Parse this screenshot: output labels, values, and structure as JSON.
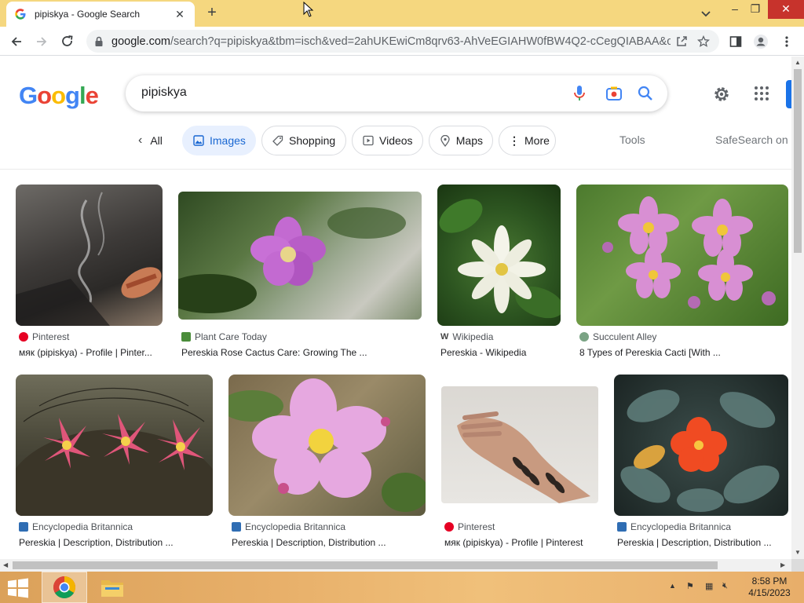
{
  "browser": {
    "tab_title": "pipiskya - Google Search",
    "url_host": "google.com",
    "url_path": "/search?q=pipiskya&tbm=isch&ved=2ahUKEwiCm8qrv63-AhVeEGIAHW0fBW4Q2-cCegQIABAA&oq..."
  },
  "search": {
    "logo": "Google",
    "query": "pipiskya"
  },
  "nav": {
    "all": "All",
    "images": "Images",
    "shopping": "Shopping",
    "videos": "Videos",
    "maps": "Maps",
    "more": "More",
    "tools": "Tools",
    "safesearch": "SafeSearch on"
  },
  "results": [
    {
      "source": "Pinterest",
      "title": "мяк (pipiskya) - Profile | Pinter...",
      "icon": "pinterest-icon",
      "icon_color": "#e60023"
    },
    {
      "source": "Plant Care Today",
      "title": "Pereskia Rose Cactus Care: Growing The ...",
      "icon": "leaf-icon",
      "icon_color": "#4a8c3a"
    },
    {
      "source": "Wikipedia",
      "title": "Pereskia - Wikipedia",
      "icon": "wikipedia-icon",
      "icon_color": "#444444"
    },
    {
      "source": "Succulent Alley",
      "title": "8 Types of Pereskia Cacti [With ...",
      "icon": "succulent-icon",
      "icon_color": "#7aa384"
    },
    {
      "source": "Encyclopedia Britannica",
      "title": "Pereskia | Description, Distribution ...",
      "icon": "britannica-icon",
      "icon_color": "#2f6db3"
    },
    {
      "source": "Encyclopedia Britannica",
      "title": "Pereskia | Description, Distribution ...",
      "icon": "britannica-icon",
      "icon_color": "#2f6db3"
    },
    {
      "source": "Pinterest",
      "title": "мяк (pipiskya) - Profile | Pinterest",
      "icon": "pinterest-icon",
      "icon_color": "#e60023"
    },
    {
      "source": "Encyclopedia Britannica",
      "title": "Pereskia | Description, Distribution ...",
      "icon": "britannica-icon",
      "icon_color": "#2f6db3"
    }
  ],
  "taskbar": {
    "time": "8:58 PM",
    "date": "4/15/2023"
  }
}
